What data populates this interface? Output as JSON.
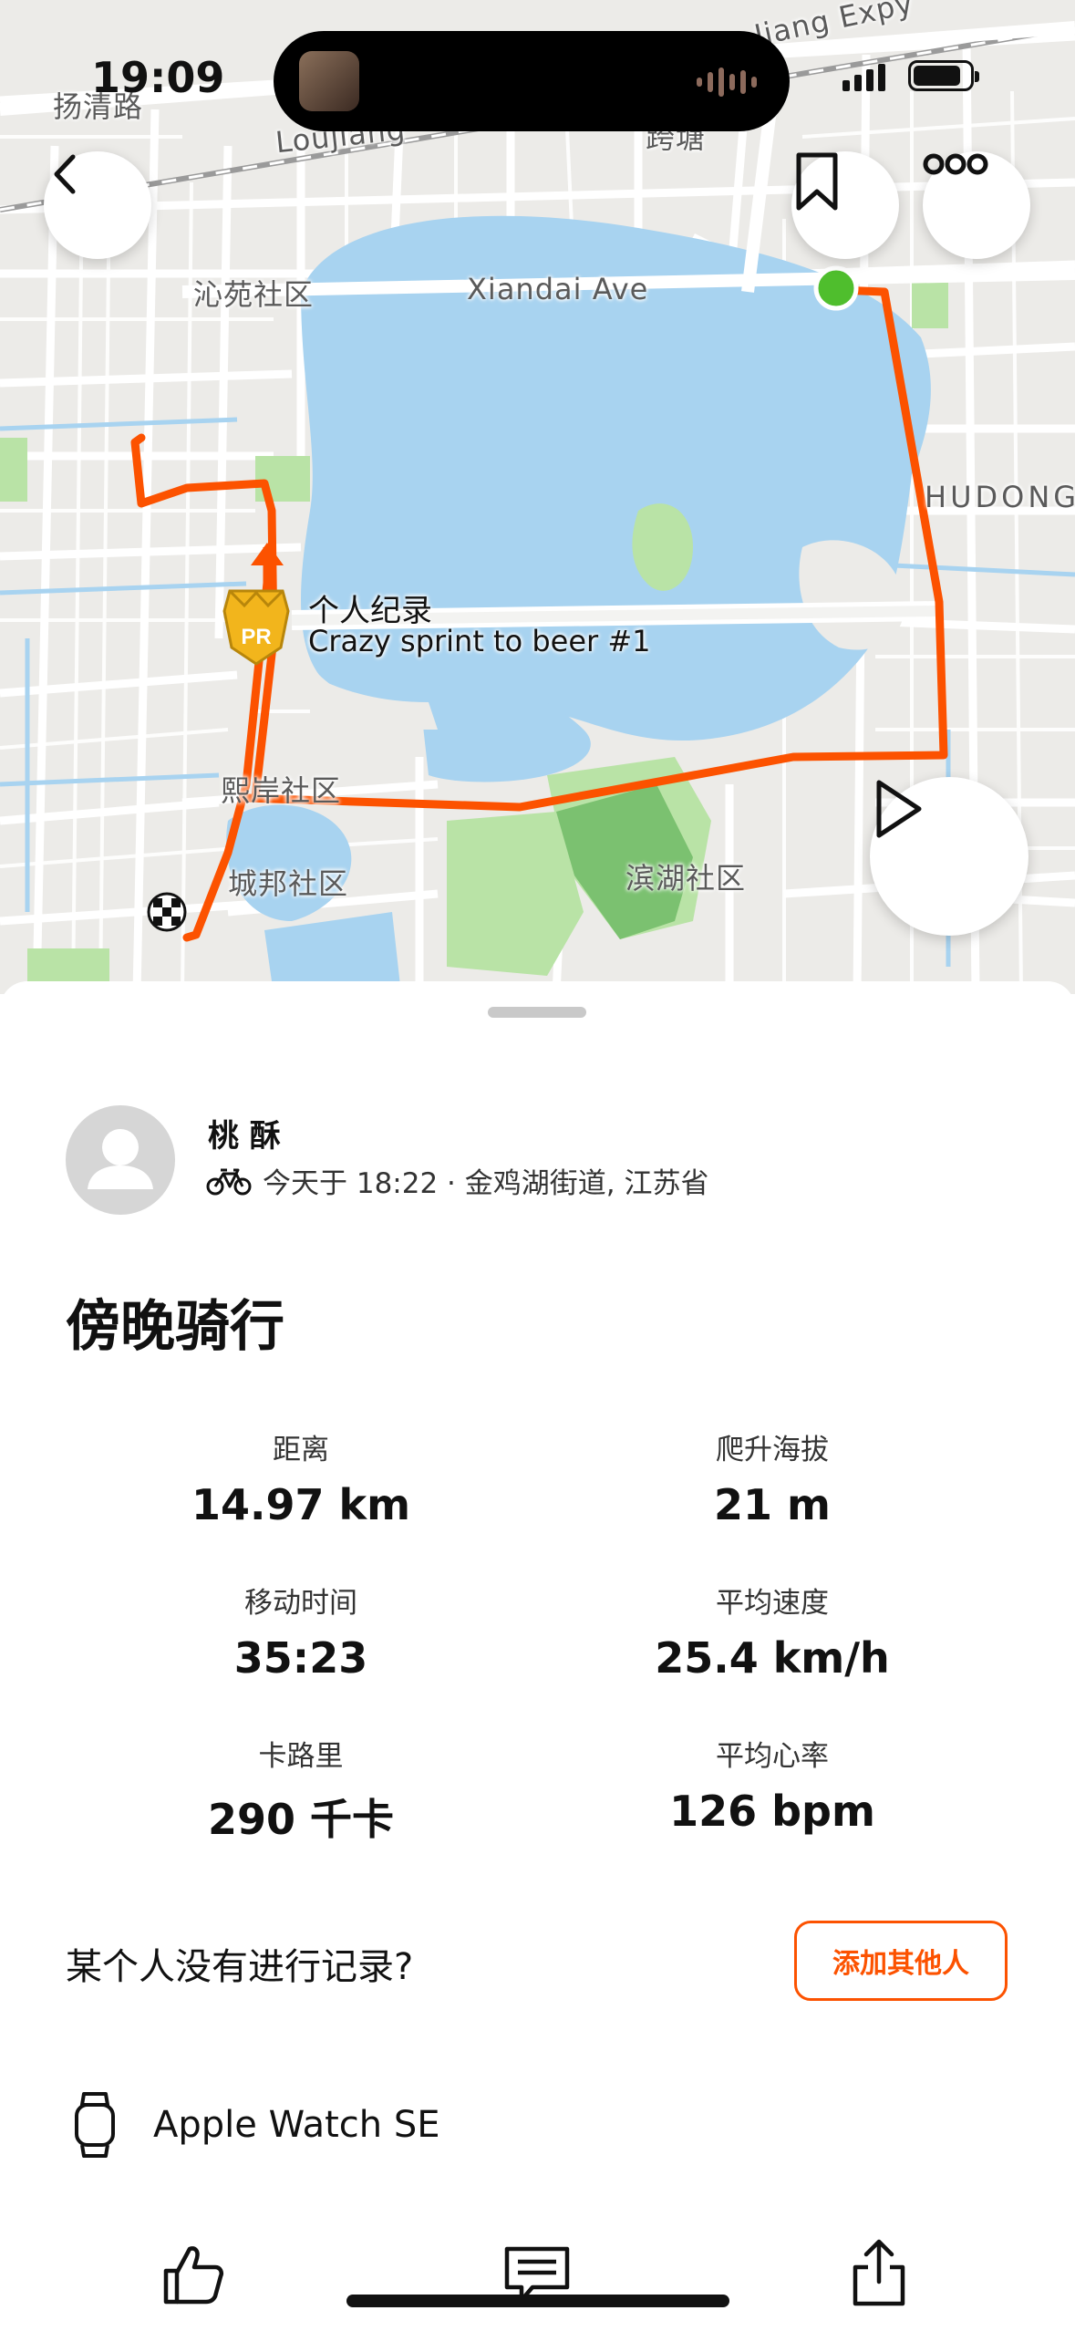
{
  "status_bar": {
    "time": "19:09"
  },
  "map": {
    "labels": {
      "yangqing": "扬清路",
      "loujiang": "Loujiang",
      "kuatang": "跨塘",
      "jiang_expy": "Jiang Expy",
      "qinyuan": "沁苑社区",
      "xiandai": "Xiandai Ave",
      "hudong": "HUDONG",
      "xian": "熙岸社区",
      "chengbang": "城邦社区",
      "binhu": "滨湖社区"
    },
    "pr_badge": "PR",
    "pr_title": "个人纪录",
    "pr_segment": "Crazy sprint to beer #1",
    "route_color": "#fc5200"
  },
  "nav": {
    "back_icon": "chevron-left-icon",
    "bookmark_icon": "bookmark-icon",
    "more_icon": "more-icon",
    "play_icon": "play-icon"
  },
  "activity": {
    "athlete_name": "桃 酥",
    "meta": "今天于 18:22 · 金鸡湖街道, 江苏省",
    "sport_icon": "bike-icon",
    "title": "傍晚骑行",
    "stats": [
      {
        "label": "距离",
        "value": "14.97 km"
      },
      {
        "label": "爬升海拔",
        "value": "21 m"
      },
      {
        "label": "移动时间",
        "value": "35:23"
      },
      {
        "label": "平均速度",
        "value": "25.4 km/h"
      },
      {
        "label": "卡路里",
        "value": "290 千卡"
      },
      {
        "label": "平均心率",
        "value": "126 bpm"
      }
    ]
  },
  "someone_missing": {
    "text": "某个人没有进行记录?",
    "button": "添加其他人"
  },
  "device": {
    "name": "Apple Watch SE",
    "icon": "watch-icon"
  },
  "bottom_bar": {
    "like_icon": "thumbs-up-icon",
    "comment_icon": "comment-icon",
    "share_icon": "share-icon"
  },
  "colors": {
    "accent": "#fc5200",
    "water": "#a8d3f0",
    "park": "#b9e3a6"
  }
}
